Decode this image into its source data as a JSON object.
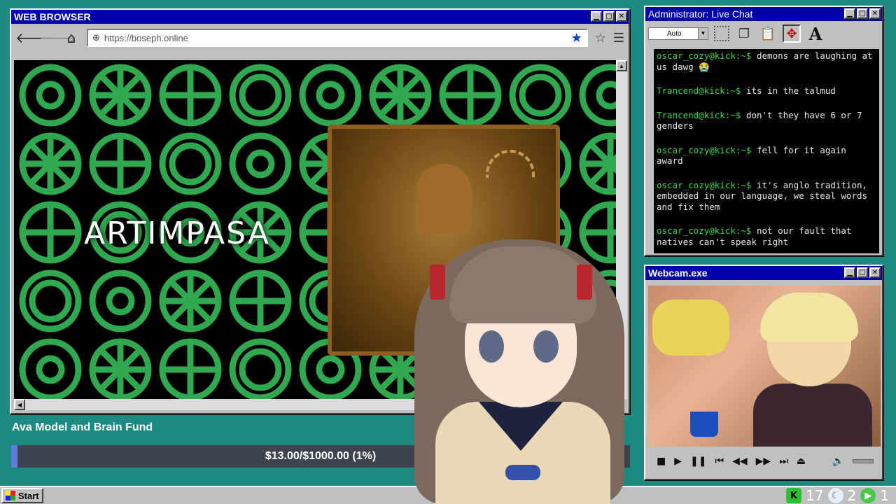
{
  "browser": {
    "title": "WEB BROWSER",
    "url": "https://boseph.online",
    "page_heading": "ARTIMPASA"
  },
  "chat": {
    "title": "Administrator: Live Chat",
    "zoom_select": "Auto",
    "messages": [
      {
        "user": "oscar_cozy@kick:~$",
        "text": "demons are laughing at us dawg 😭"
      },
      {
        "user": "Trancend@kick:~$",
        "text": "its in the talmud"
      },
      {
        "user": "Trancend@kick:~$",
        "text": "don't they have 6 or 7 genders"
      },
      {
        "user": "oscar_cozy@kick:~$",
        "text": "fell for it again award"
      },
      {
        "user": "oscar_cozy@kick:~$",
        "text": "it's anglo tradition, embedded in our language, we steal words and fix them"
      },
      {
        "user": "oscar_cozy@kick:~$",
        "text": "not our fault that natives can't speak right"
      }
    ]
  },
  "webcam": {
    "title": "Webcam.exe"
  },
  "fund": {
    "label": "Ava Model and Brain Fund",
    "progress_text": "$13.00/$1000.00 (1%)",
    "progress_percent": 1
  },
  "taskbar": {
    "start_label": "Start",
    "kick_count": "17",
    "moon_count": "2",
    "play_count": "1"
  },
  "colors": {
    "titlebar": "#0000aa",
    "desktop": "#1b8a80",
    "chat_user": "#3bd64b",
    "bookmark_star": "#0b3fc6"
  }
}
